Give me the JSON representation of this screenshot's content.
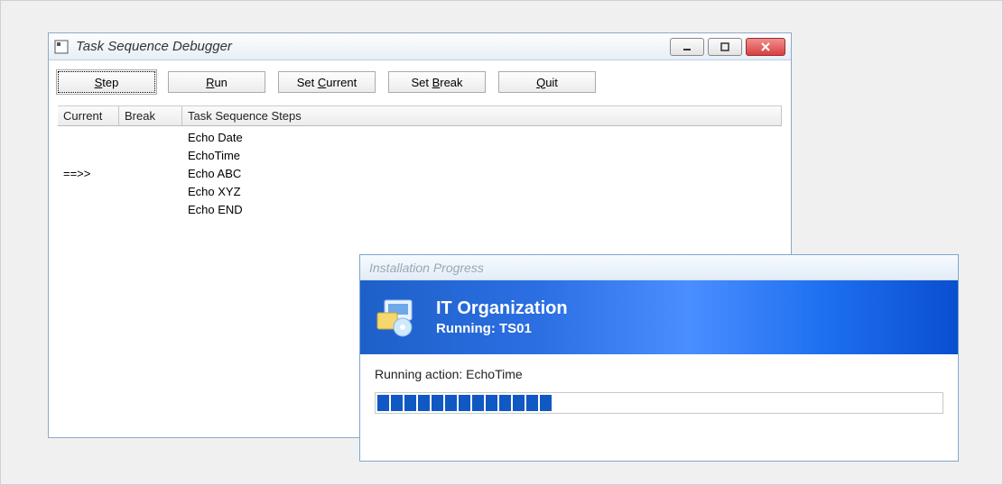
{
  "debugger": {
    "title": "Task Sequence Debugger",
    "toolbar": {
      "step": {
        "pre": "",
        "mn": "S",
        "post": "tep"
      },
      "run": {
        "pre": "",
        "mn": "R",
        "post": "un"
      },
      "setCurrent": {
        "pre": "Set ",
        "mn": "C",
        "post": "urrent"
      },
      "setBreak": {
        "pre": "Set ",
        "mn": "B",
        "post": "reak"
      },
      "quit": {
        "pre": "",
        "mn": "Q",
        "post": "uit"
      }
    },
    "columns": {
      "current": "Current",
      "break": "Break",
      "steps": "Task Sequence Steps"
    },
    "rows": [
      {
        "current": "",
        "break": "",
        "step": "Echo Date"
      },
      {
        "current": "",
        "break": "",
        "step": "EchoTime"
      },
      {
        "current": "==>>",
        "break": "",
        "step": "Echo ABC"
      },
      {
        "current": "",
        "break": "",
        "step": "Echo XYZ"
      },
      {
        "current": "",
        "break": "",
        "step": "Echo END"
      }
    ]
  },
  "progress": {
    "title": "Installation Progress",
    "org": "IT Organization",
    "runningLabel": "Running: TS01",
    "actionLabel": "Running action: EchoTime",
    "blocks": 13,
    "totalBlocks": 43
  }
}
